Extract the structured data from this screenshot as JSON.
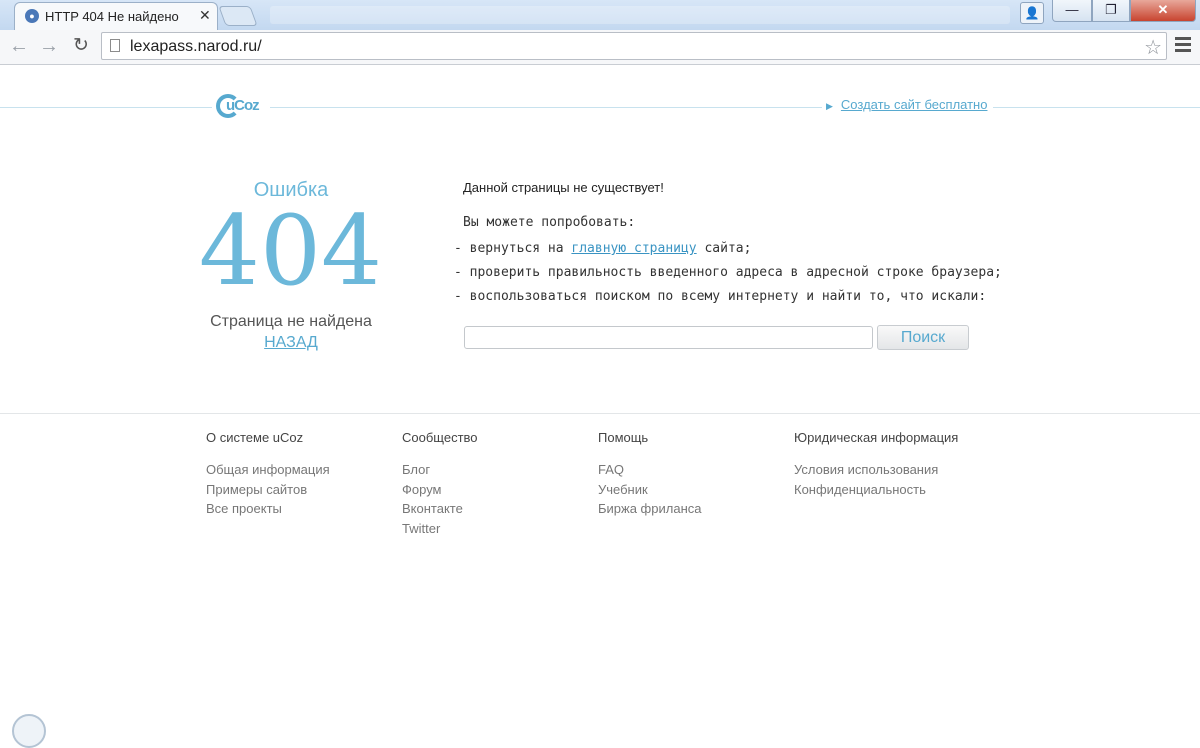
{
  "browser": {
    "tab_title": "HTTP 404 Не найдено",
    "tab_close": "✕",
    "url": "lexapass.narod.ru/",
    "back_icon": "arrow-left",
    "forward_icon": "arrow-right",
    "reload_icon": "reload",
    "star_icon": "star",
    "menu_icon": "hamburger",
    "window_buttons": {
      "minimize": "—",
      "maximize": "❐",
      "close": "✕"
    }
  },
  "header": {
    "logo_text": "uCoz",
    "create_site_link": "Создать сайт бесплатно",
    "accent_color": "#57a9cf"
  },
  "error": {
    "word": "Ошибка",
    "code": "404",
    "subtitle": "Страница не найдена",
    "back_link": "НАЗАД"
  },
  "message": {
    "title": "Данной страницы не существует!",
    "try_text": "Вы можете попробовать:",
    "option1_prefix": "- вернуться на ",
    "option1_link": "главную страницу",
    "option1_suffix": " сайта;",
    "option2": "- проверить правильность введенного адреса в адресной строке браузера;",
    "option3": "- воспользоваться поиском по всему интернету и найти то, что искали:"
  },
  "search": {
    "placeholder": "",
    "button_label": "Поиск"
  },
  "footer": {
    "columns": [
      {
        "title": "О системе uCoz",
        "items": [
          "Общая информация",
          "Примеры сайтов",
          "Все проекты"
        ]
      },
      {
        "title": "Сообщество",
        "items": [
          "Блог",
          "Форум",
          "Вконтакте",
          "Twitter"
        ]
      },
      {
        "title": "Помощь",
        "items": [
          "FAQ",
          "Учебник",
          "Биржа фриланса"
        ]
      },
      {
        "title": "Юридическая информация",
        "items": [
          "Условия использования",
          "Конфиденциальность"
        ]
      }
    ]
  }
}
